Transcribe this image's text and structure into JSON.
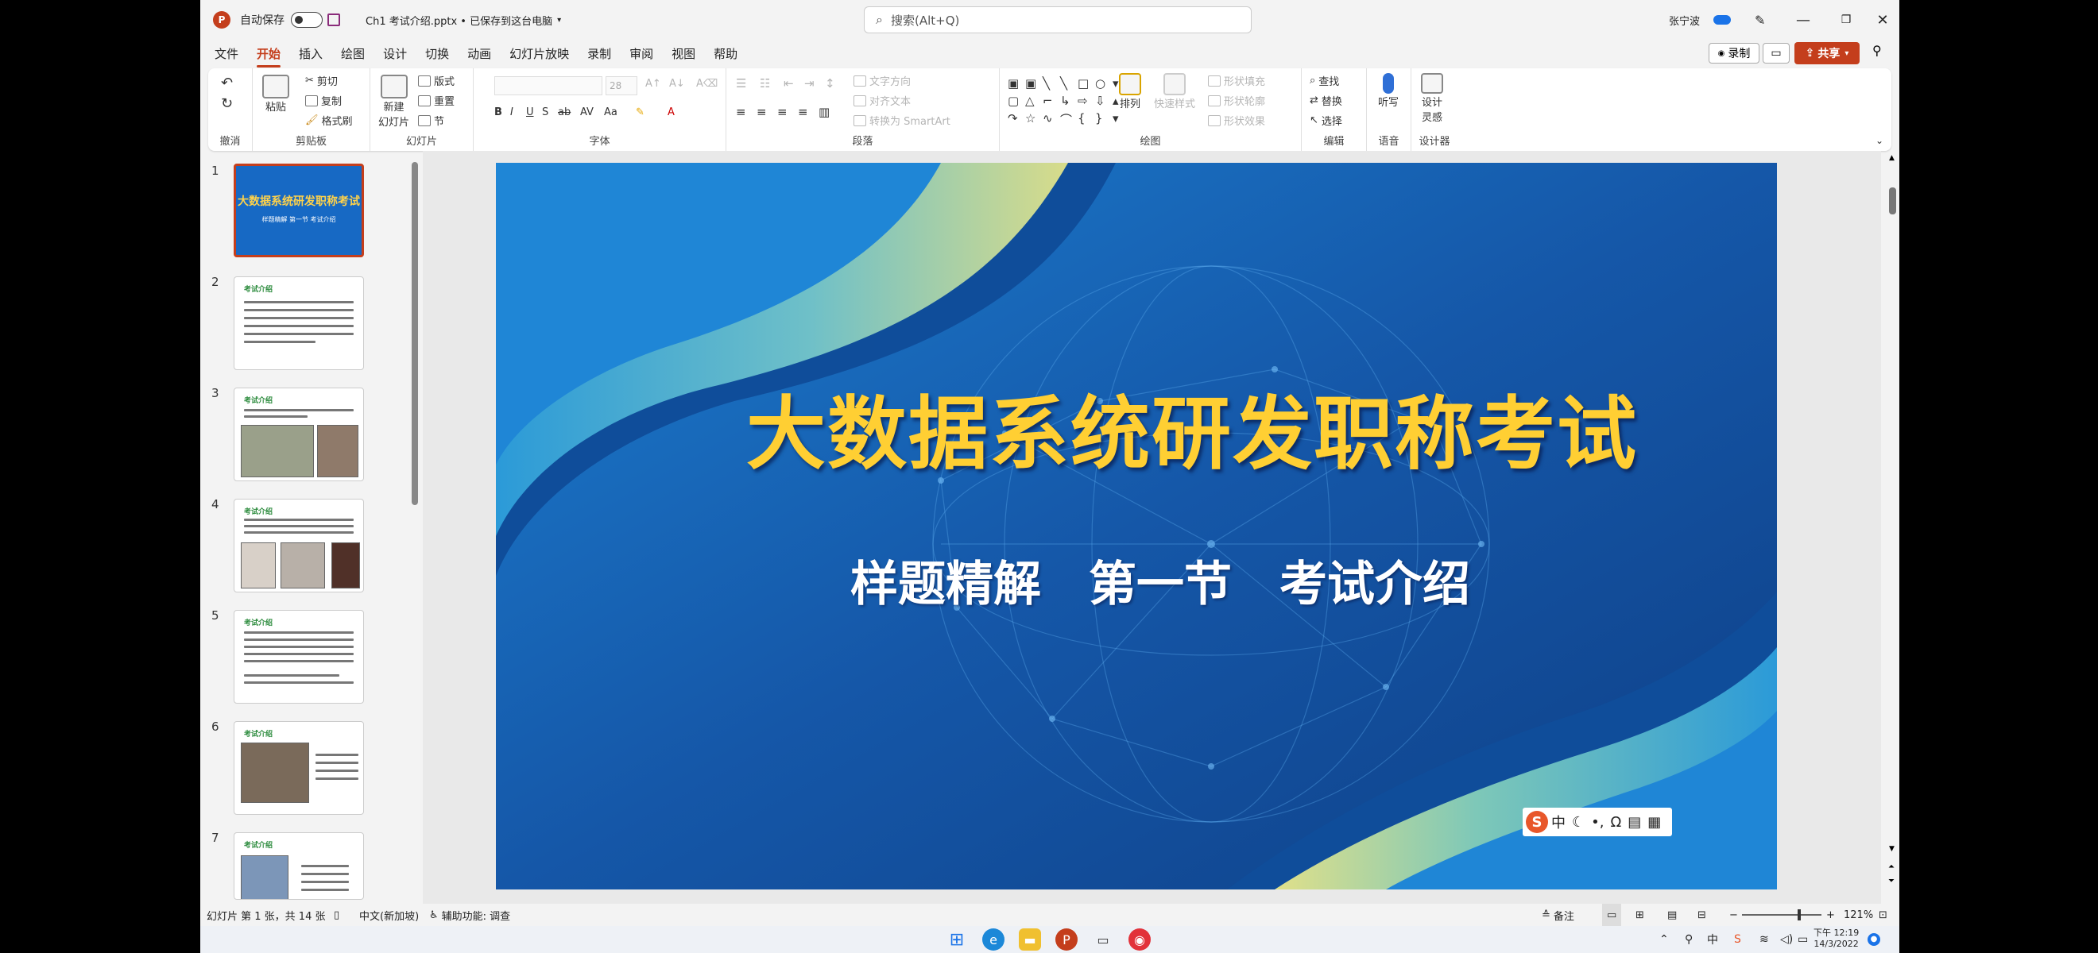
{
  "titlebar": {
    "autosave_label": "自动保存",
    "autosave_state": "关",
    "doc_title": "Ch1 考试介绍.pptx • 已保存到这台电脑",
    "search_placeholder": "搜索(Alt+Q)",
    "user_name": "张宁波"
  },
  "menu": {
    "tabs": [
      "文件",
      "开始",
      "插入",
      "绘图",
      "设计",
      "切换",
      "动画",
      "幻灯片放映",
      "录制",
      "审阅",
      "视图",
      "帮助"
    ],
    "active_tab": "开始",
    "record_label": "录制",
    "share_label": "共享"
  },
  "ribbon": {
    "undo_group": "撤消",
    "clipboard": {
      "label": "剪贴板",
      "paste": "粘贴",
      "cut": "剪切",
      "copy": "复制",
      "format_painter": "格式刷"
    },
    "slides": {
      "label": "幻灯片",
      "new_slide": "新建\n幻灯片",
      "layout": "版式",
      "reset": "重置",
      "section": "节"
    },
    "font": {
      "label": "字体",
      "size": "28"
    },
    "paragraph": {
      "label": "段落",
      "text_direction": "文字方向",
      "align_text": "对齐文本",
      "smartart": "转换为 SmartArt"
    },
    "drawing": {
      "label": "绘图",
      "arrange": "排列",
      "quick_styles": "快速样式",
      "shape_fill": "形状填充",
      "shape_outline": "形状轮廓",
      "shape_effects": "形状效果"
    },
    "editing": {
      "label": "编辑",
      "find": "查找",
      "replace": "替换",
      "select": "选择"
    },
    "voice": {
      "label": "语音",
      "dictate": "听写"
    },
    "designer": {
      "label": "设计器",
      "design_ideas": "设计\n灵感"
    }
  },
  "thumbnails": {
    "numbers": [
      "1",
      "2",
      "3",
      "4",
      "5",
      "6",
      "7"
    ],
    "slide1_title": "大数据系统研发职称考试",
    "slide1_sub": "样题精解  第一节  考试介绍",
    "other_title": "考试介绍"
  },
  "slide": {
    "title": "大数据系统研发职称考试",
    "subtitle": "样题精解　第一节　考试介绍",
    "ime_label": "中",
    "bg_color": "#1a5fb0",
    "title_color": "#ffcf33"
  },
  "status": {
    "slide_info": "幻灯片 第 1 张，共 14 张",
    "language": "中文(新加坡)",
    "accessibility": "辅助功能: 调查",
    "notes": "备注",
    "zoom": "121%"
  },
  "taskbar": {
    "tray_ime": "中",
    "time": "下午 12:19",
    "date": "14/3/2022"
  }
}
